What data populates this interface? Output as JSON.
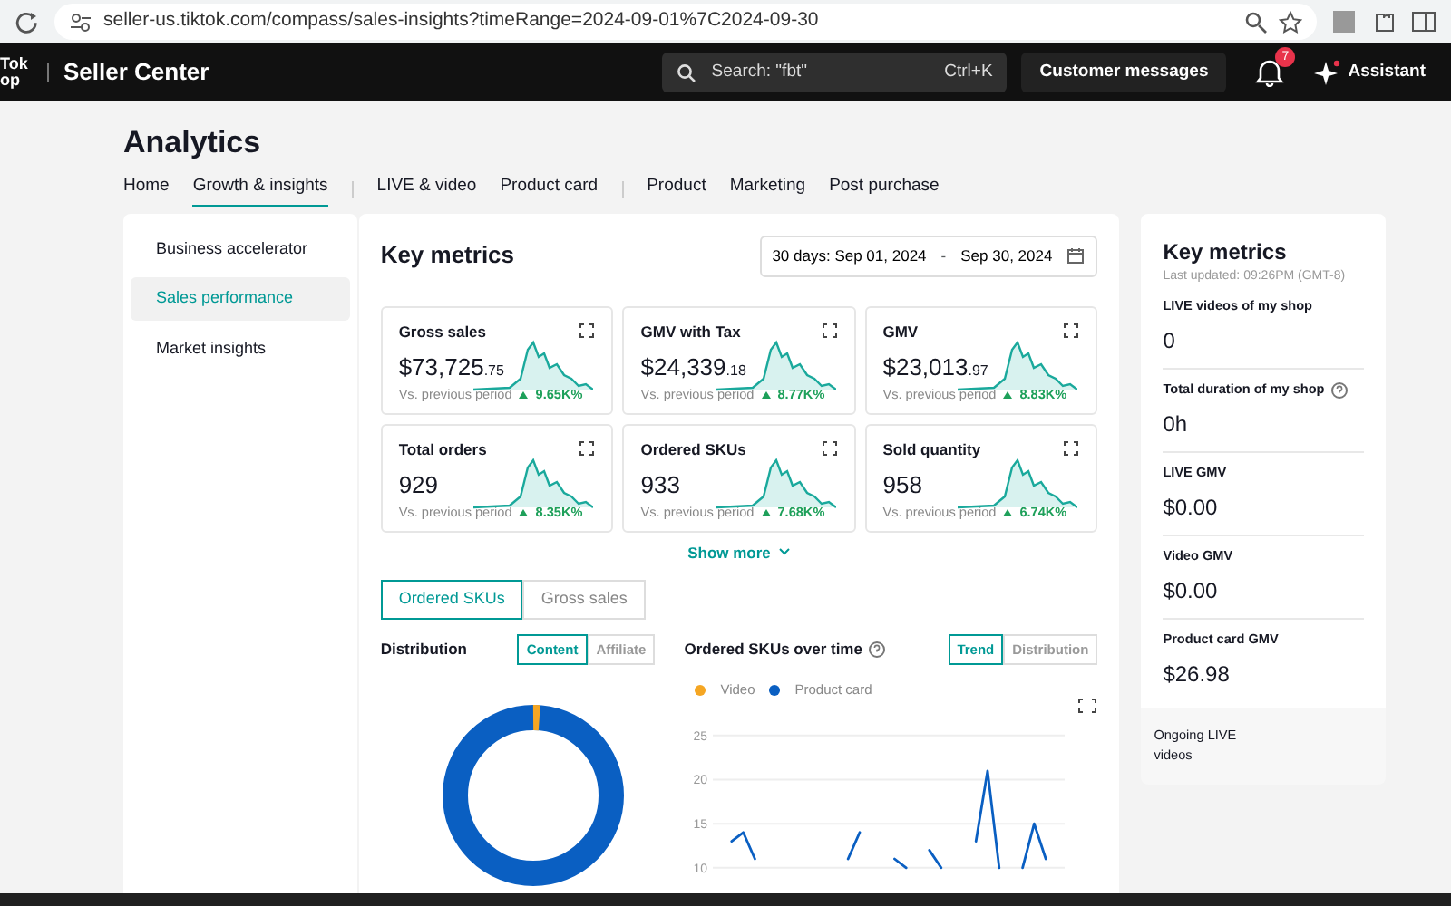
{
  "browser": {
    "url": "seller-us.tiktok.com/compass/sales-insights?timeRange=2024-09-01%7C2024-09-30"
  },
  "header": {
    "logo_lines": [
      "Tok",
      "op"
    ],
    "title": "Seller Center",
    "search": {
      "placeholder": "Search: \"fbt\"",
      "shortcut": "Ctrl+K"
    },
    "messages_button": "Customer messages",
    "notification_count": "7",
    "assistant": "Assistant"
  },
  "page_title": "Analytics",
  "tab_groups": [
    [
      {
        "label": "Home",
        "selected": false
      },
      {
        "label": "Growth & insights",
        "selected": true
      }
    ],
    [
      {
        "label": "LIVE & video",
        "selected": false
      },
      {
        "label": "Product card",
        "selected": false
      }
    ],
    [
      {
        "label": "Product",
        "selected": false
      },
      {
        "label": "Marketing",
        "selected": false
      },
      {
        "label": "Post purchase",
        "selected": false
      }
    ]
  ],
  "sidebar": {
    "items": [
      {
        "label": "Business accelerator",
        "selected": false
      },
      {
        "label": "Sales performance",
        "selected": true
      },
      {
        "label": "Market insights",
        "selected": false
      }
    ]
  },
  "key_metrics": {
    "title": "Key metrics",
    "date_range": {
      "prefix": "30 days:",
      "start": "Sep 01, 2024",
      "separator": "-",
      "end": "Sep 30, 2024"
    },
    "metrics": [
      {
        "label": "Gross sales",
        "value": "$73,725",
        "decimals": ".75",
        "compare_label": "Vs. previous period",
        "change": "9.65K%"
      },
      {
        "label": "GMV with Tax",
        "value": "$24,339",
        "decimals": ".18",
        "compare_label": "Vs. previous period",
        "change": "8.77K%"
      },
      {
        "label": "GMV",
        "value": "$23,013",
        "decimals": ".97",
        "compare_label": "Vs. previous period",
        "change": "8.83K%"
      },
      {
        "label": "Total orders",
        "value": "929",
        "compare_label": "Vs. previous period",
        "change": "8.35K%"
      },
      {
        "label": "Ordered SKUs",
        "value": "933",
        "compare_label": "Vs. previous period",
        "change": "7.68K%"
      },
      {
        "label": "Sold quantity",
        "value": "958",
        "compare_label": "Vs. previous period",
        "change": "6.74K%"
      }
    ],
    "show_more": "Show more"
  },
  "metric_tabs": [
    {
      "label": "Ordered SKUs",
      "selected": true
    },
    {
      "label": "Gross sales",
      "selected": false
    }
  ],
  "distribution": {
    "title": "Distribution",
    "toggle": [
      {
        "label": "Content",
        "selected": true
      },
      {
        "label": "Affiliate",
        "selected": false
      }
    ]
  },
  "over_time": {
    "title": "Ordered SKUs over time",
    "toggle": [
      {
        "label": "Trend",
        "selected": true
      },
      {
        "label": "Distribution",
        "selected": false
      }
    ],
    "chart_data": {
      "type": "line",
      "grid": true,
      "ylim": [
        10,
        25
      ],
      "yticks": [
        10,
        15,
        20,
        25
      ],
      "series": [
        {
          "name": "Video",
          "color": "#f5a623",
          "values": [
            null,
            null,
            null,
            null,
            null,
            null,
            null,
            null,
            null,
            null,
            null,
            null,
            null,
            null,
            null,
            null,
            null,
            null,
            null,
            null,
            null,
            null,
            null,
            null,
            null,
            null,
            null,
            null,
            null,
            null
          ]
        },
        {
          "name": "Product card",
          "color": "#0a5fc2",
          "values": [
            null,
            13,
            14,
            11,
            null,
            null,
            null,
            null,
            null,
            null,
            null,
            11,
            14,
            null,
            null,
            11,
            10,
            null,
            12,
            10,
            null,
            null,
            13,
            21,
            10,
            null,
            10,
            15,
            11,
            null
          ]
        }
      ]
    }
  },
  "side_panel": {
    "title": "Key metrics",
    "last_updated": "Last updated: 09:26PM (GMT-8)",
    "items": [
      {
        "label": "LIVE videos of my shop",
        "value": "0",
        "help": false
      },
      {
        "label": "Total duration of my shop",
        "value": "0h",
        "help": true
      },
      {
        "label": "LIVE GMV",
        "value": "$0.00",
        "help": false
      },
      {
        "label": "Video GMV",
        "value": "$0.00",
        "help": false
      },
      {
        "label": "Product card GMV",
        "value": "$26.98",
        "help": false
      }
    ],
    "ongoing": "Ongoing LIVE videos"
  }
}
